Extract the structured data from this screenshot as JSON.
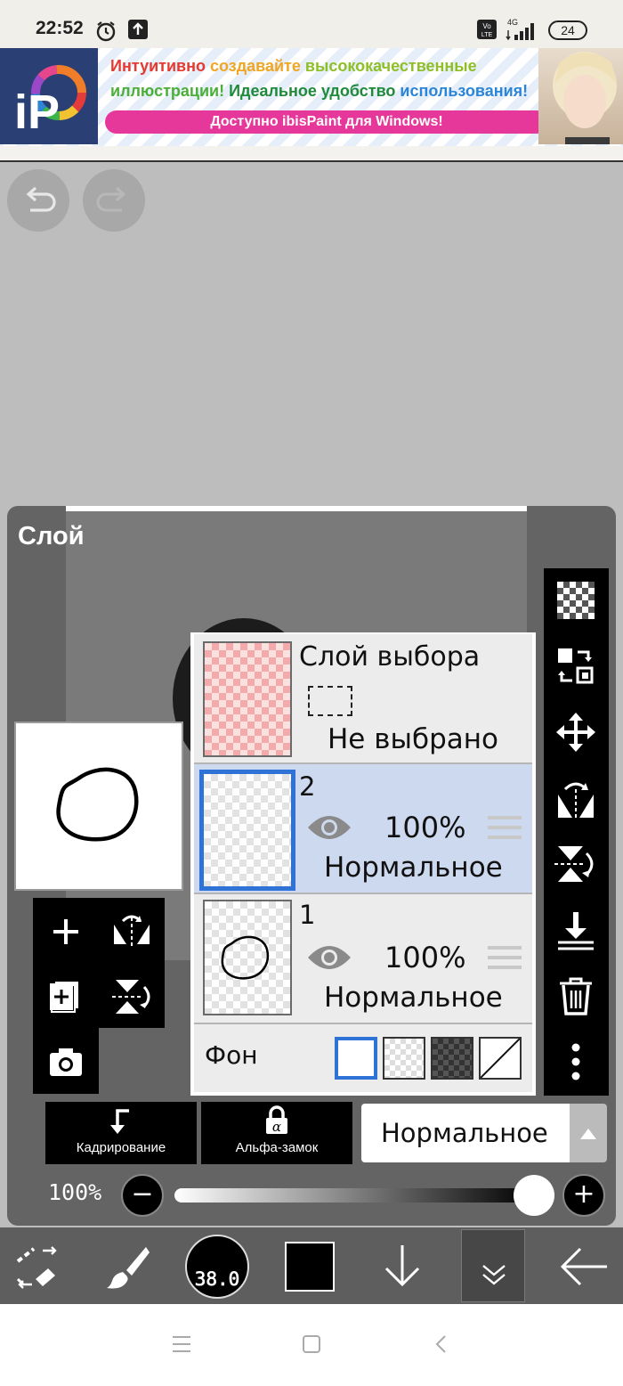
{
  "status_bar": {
    "time": "22:52",
    "network": "4G",
    "battery": "24"
  },
  "ad": {
    "line1_a": "Интуитивно",
    "line1_b": "создавайте",
    "line1_c": "высококачественные",
    "line2_a": "иллюстрации!",
    "line2_b": "Идеальное удобство",
    "line2_c": "использования!",
    "cta": "Доступно ibisPaint для Windows!",
    "logo_text": "iP"
  },
  "panel": {
    "title": "Слой",
    "selection_layer": {
      "name": "Слой выбора",
      "state": "Не выбрано"
    },
    "layers": [
      {
        "number": "2",
        "opacity": "100%",
        "mode": "Нормальное",
        "selected": true
      },
      {
        "number": "1",
        "opacity": "100%",
        "mode": "Нормальное",
        "selected": false
      }
    ],
    "background_label": "Фон",
    "crop_label": "Кадрирование",
    "alpha_lock_label": "Альфа-замок",
    "blend_mode": "Нормальное",
    "opacity_label": "100%",
    "opacity_value": 1.0
  },
  "bottom_toolbar": {
    "brush_size": "38.0"
  },
  "colors": {
    "accent": "#2f73d6",
    "panel": "#646464",
    "toolbar": "#000000"
  }
}
